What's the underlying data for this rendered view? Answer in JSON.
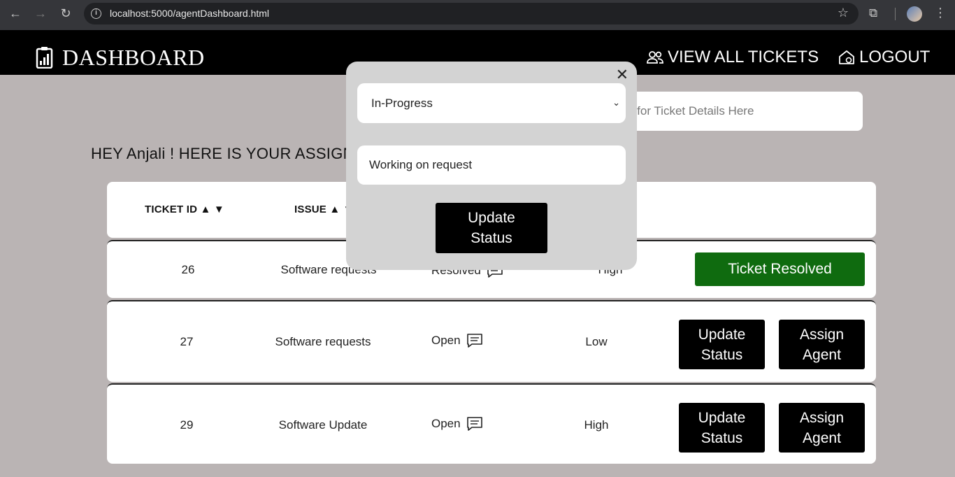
{
  "browser": {
    "url": "localhost:5000/agentDashboard.html"
  },
  "header": {
    "brand": "DASHBOARD",
    "view_all_tickets": "VIEW ALL TICKETS",
    "logout": "LOGOUT"
  },
  "search": {
    "placeholder": "h for Ticket Details Here"
  },
  "greeting": "HEY Anjali ! HERE IS YOUR ASSIGNE",
  "table": {
    "headers": {
      "ticket_id": "TICKET ID ▲ ▼",
      "issue": "ISSUE ▲ ▼"
    },
    "rows": [
      {
        "id": "26",
        "issue": "Software requests",
        "status": "Resolved",
        "priority": "High",
        "action": "Ticket Resolved"
      },
      {
        "id": "27",
        "issue": "Software requests",
        "status": "Open",
        "priority": "Low",
        "update_label_1": "Update",
        "update_label_2": "Status",
        "assign_label_1": "Assign",
        "assign_label_2": "Agent"
      },
      {
        "id": "29",
        "issue": "Software Update",
        "status": "Open",
        "priority": "High",
        "update_label_1": "Update",
        "update_label_2": "Status",
        "assign_label_1": "Assign",
        "assign_label_2": "Agent"
      }
    ]
  },
  "modal": {
    "close": "✕",
    "status_selected": "In-Progress",
    "comment_value": "Working on request",
    "submit_line1": "Update",
    "submit_line2": "Status"
  },
  "colors": {
    "background": "#bab4b4",
    "header": "#000000",
    "resolved_button": "#0f6b0f",
    "modal": "#d3d3d3"
  }
}
